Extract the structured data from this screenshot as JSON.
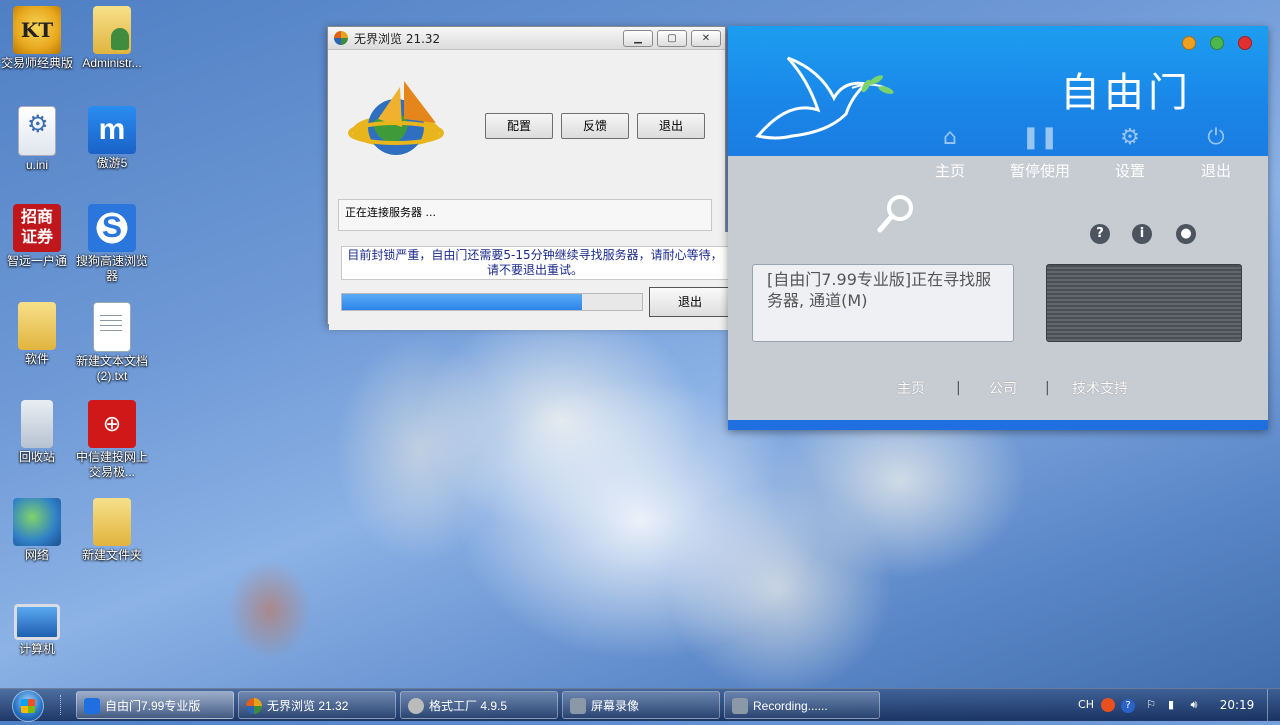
{
  "desktop": {
    "icons": [
      {
        "label": "交易师经典版"
      },
      {
        "label": "Administr..."
      },
      {
        "label": "u.ini"
      },
      {
        "label": "傲游5"
      },
      {
        "label": "智远一户通"
      },
      {
        "label": "搜狗高速浏览器"
      },
      {
        "label": "软件"
      },
      {
        "label": "新建文本文档 (2).txt"
      },
      {
        "label": "回收站"
      },
      {
        "label": "中信建投网上交易极..."
      },
      {
        "label": "网络"
      },
      {
        "label": "新建文件夹"
      },
      {
        "label": "计算机"
      }
    ],
    "glyphs": {
      "kt": "KT",
      "maxthon": "m",
      "cms": "招商\n证券",
      "sogou": "S",
      "citic": "⊕"
    }
  },
  "ultrasurf": {
    "title": "无界浏览 21.32",
    "buttons": {
      "config": "配置",
      "feedback": "反馈",
      "quit": "退出"
    },
    "status": "正在连接服务器 ...",
    "notice": "目前封锁严重，自由门还需要5-15分钟继续寻找服务器，请耐心等待，请不要退出重试。",
    "progress_fraction": 0.8,
    "quit_button": "退出"
  },
  "freegate": {
    "title": "自由门",
    "nav": [
      {
        "label": "主页",
        "icon": "home-icon"
      },
      {
        "label": "暂停使用",
        "icon": "pause-icon"
      },
      {
        "label": "设置",
        "icon": "gear-icon"
      },
      {
        "label": "退出",
        "icon": "exit-icon"
      }
    ],
    "message": "[自由门7.99专业版]正在寻找服务器, 通道(M)",
    "footer_links": {
      "home": "主页",
      "company": "公司",
      "support": "技术支持"
    },
    "separator": "|",
    "colors": {
      "header": "#1a8de9",
      "body": "#c7cbd2",
      "accent": "#1f6fe0"
    }
  },
  "taskbar": {
    "tasks": [
      {
        "label": "自由门7.99专业版"
      },
      {
        "label": "无界浏览 21.32"
      },
      {
        "label": "格式工厂 4.9.5"
      },
      {
        "label": "屏幕录像"
      },
      {
        "label": "Recording......"
      }
    ],
    "tray": {
      "lang": "CH"
    },
    "clock": "20:19"
  }
}
